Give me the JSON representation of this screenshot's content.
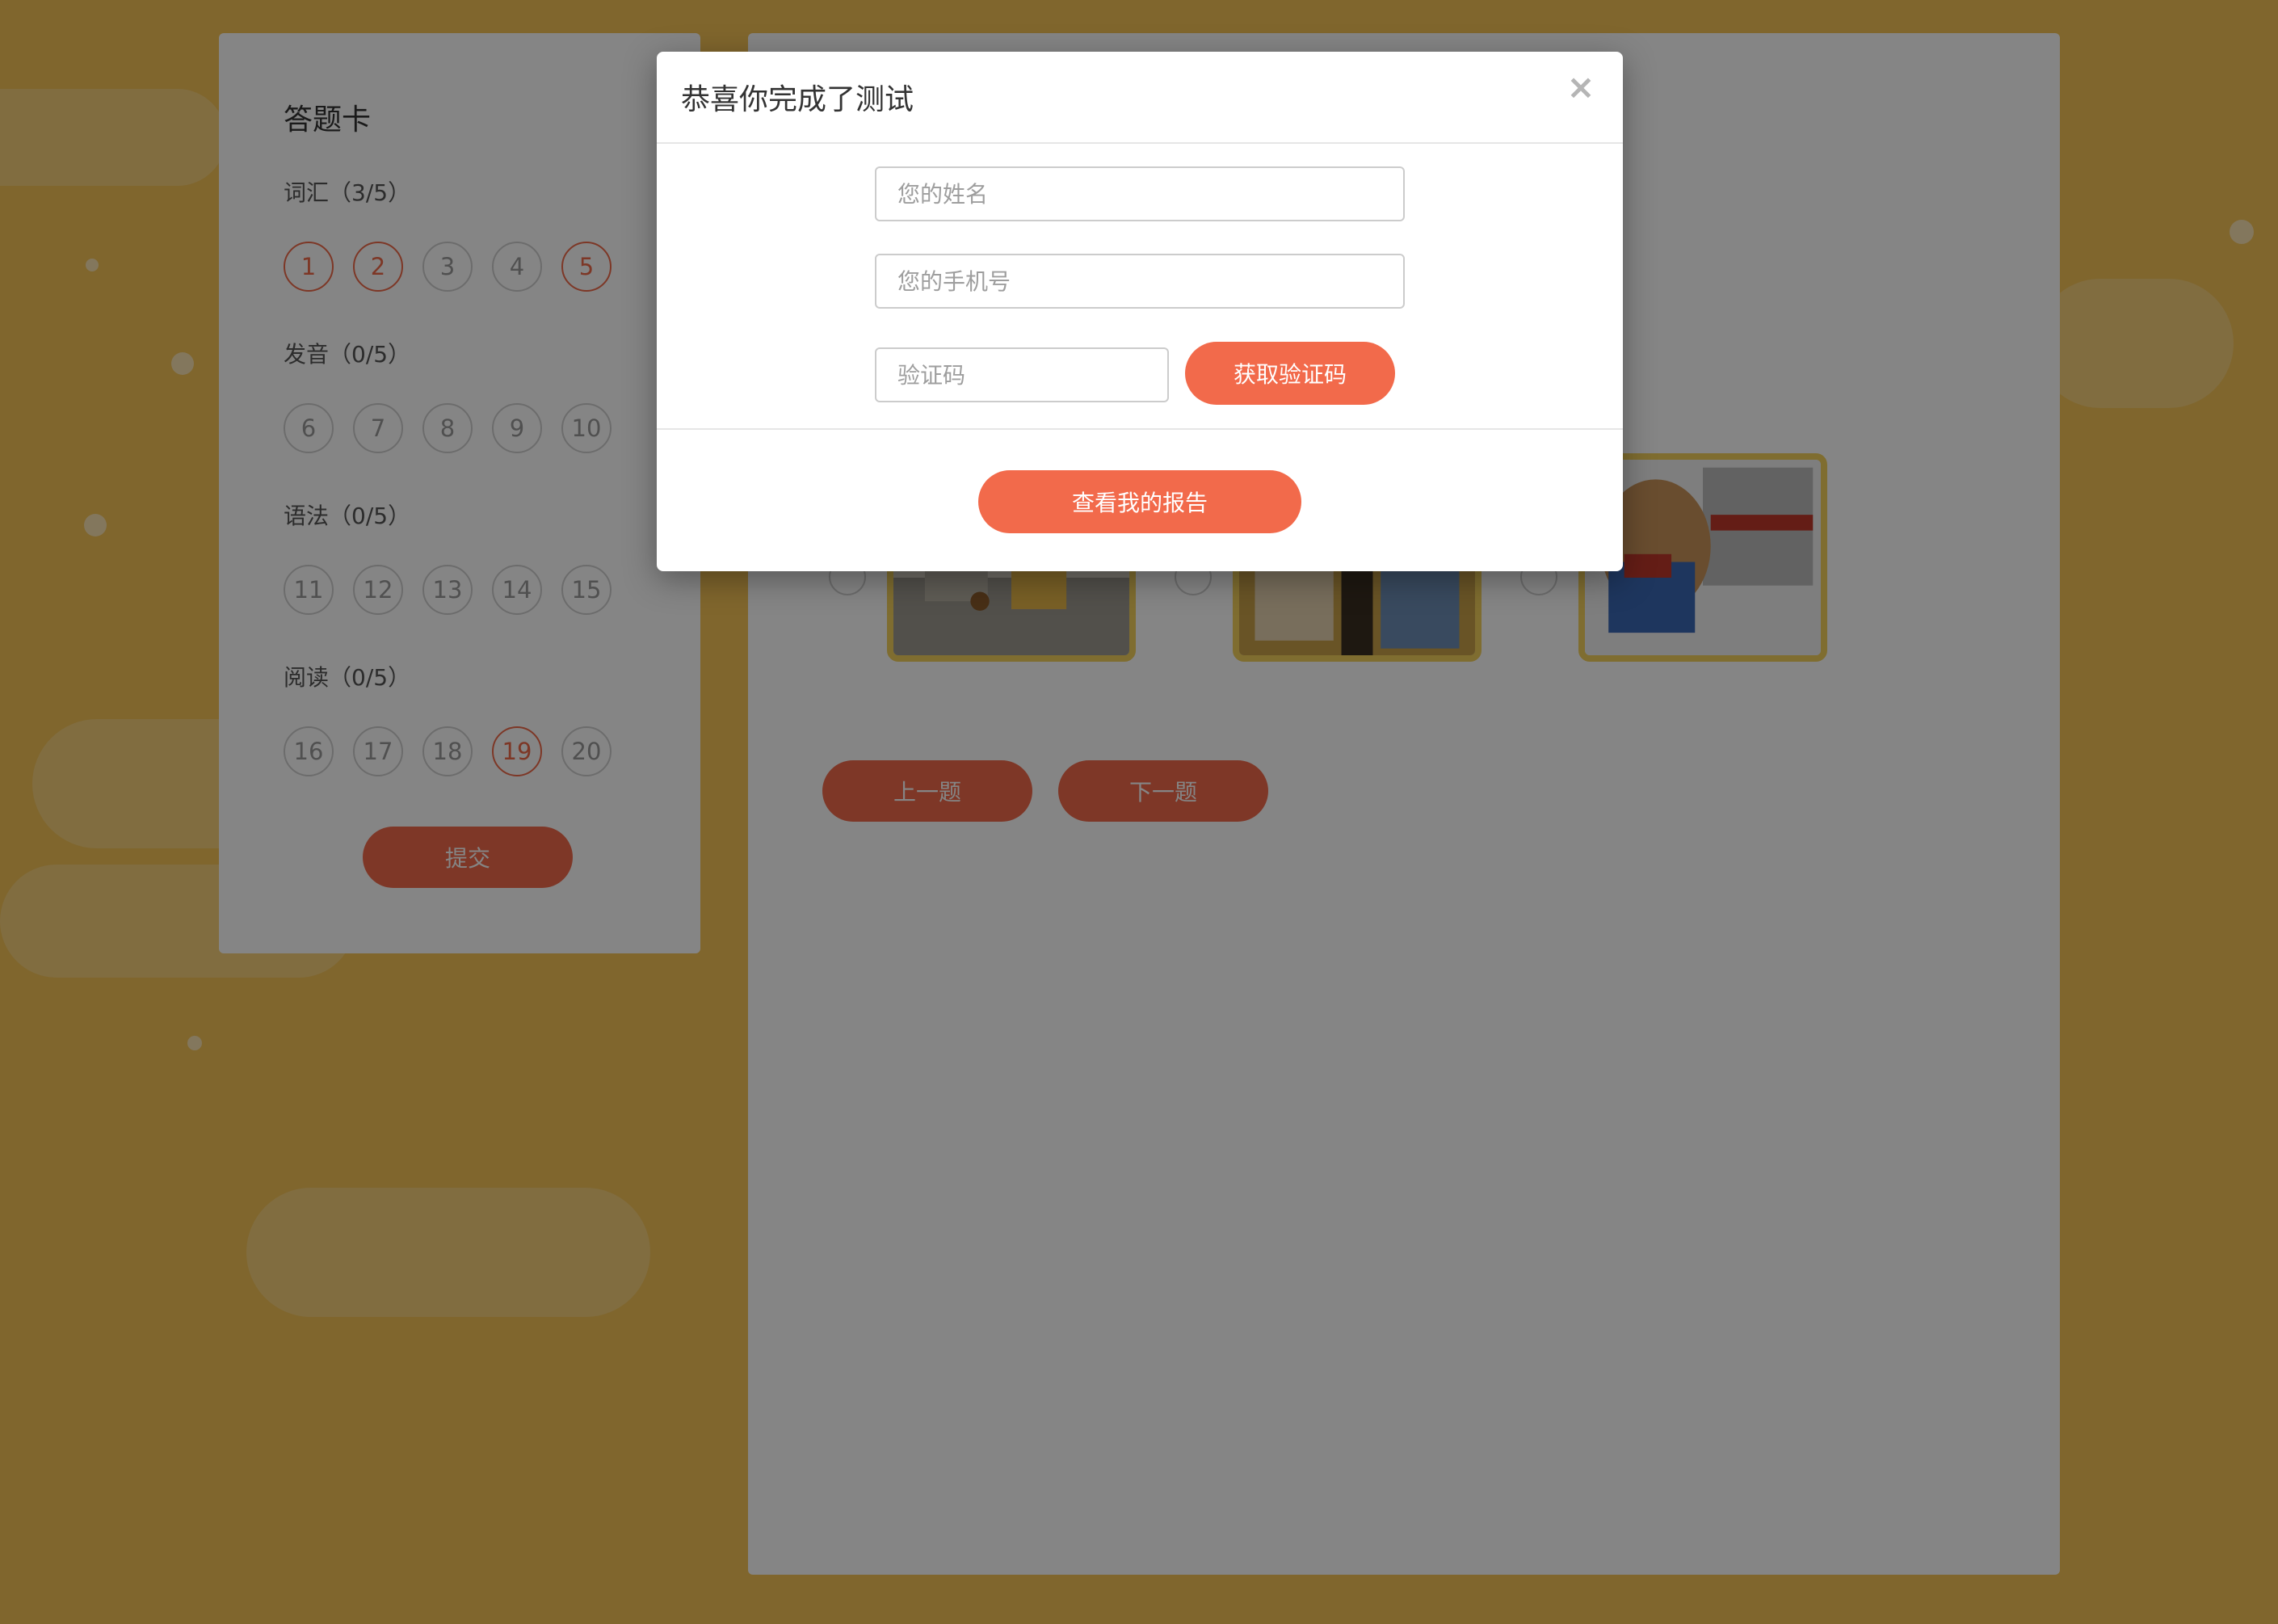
{
  "answer_card": {
    "title": "答题卡",
    "sections": [
      {
        "label": "词汇（3/5）",
        "numbers": [
          "1",
          "2",
          "3",
          "4",
          "5"
        ],
        "answered": [
          true,
          true,
          false,
          false,
          true
        ]
      },
      {
        "label": "发音（0/5）",
        "numbers": [
          "6",
          "7",
          "8",
          "9",
          "10"
        ],
        "answered": [
          false,
          false,
          false,
          false,
          false
        ]
      },
      {
        "label": "语法（0/5）",
        "numbers": [
          "11",
          "12",
          "13",
          "14",
          "15"
        ],
        "answered": [
          false,
          false,
          false,
          false,
          false
        ]
      },
      {
        "label": "阅读（0/5）",
        "numbers": [
          "16",
          "17",
          "18",
          "19",
          "20"
        ],
        "answered": [
          false,
          false,
          false,
          true,
          false
        ]
      }
    ],
    "submit_label": "提交"
  },
  "question": {
    "prev_label": "上一题",
    "next_label": "下一题"
  },
  "modal": {
    "title": "恭喜你完成了测试",
    "close_icon": "×",
    "name_placeholder": "您的姓名",
    "phone_placeholder": "您的手机号",
    "code_placeholder": "验证码",
    "get_code_label": "获取验证码",
    "report_label": "查看我的报告"
  },
  "colors": {
    "accent": "#f26a4b",
    "background": "#f6c457",
    "answered_border": "#f06a4a"
  }
}
